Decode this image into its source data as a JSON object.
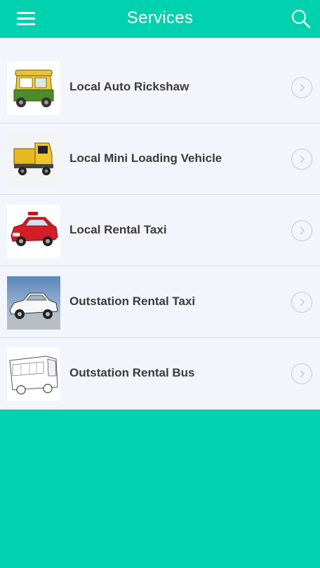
{
  "header": {
    "title": "Services",
    "menu_icon": "hamburger-menu-icon",
    "search_icon": "search-icon"
  },
  "services": [
    {
      "label": "Local Auto Rickshaw",
      "image": "auto-rickshaw-image"
    },
    {
      "label": "Local Mini Loading Vehicle",
      "image": "mini-loading-vehicle-image"
    },
    {
      "label": "Local Rental Taxi",
      "image": "red-taxi-car-image"
    },
    {
      "label": "Outstation Rental Taxi",
      "image": "white-taxi-car-image"
    },
    {
      "label": "Outstation Rental Bus",
      "image": "bus-sketch-image"
    }
  ],
  "colors": {
    "accent": "#00d1ae",
    "list_background": "#f2f5fb",
    "text": "#3b3b3b",
    "separator": "#d8dbe0"
  }
}
